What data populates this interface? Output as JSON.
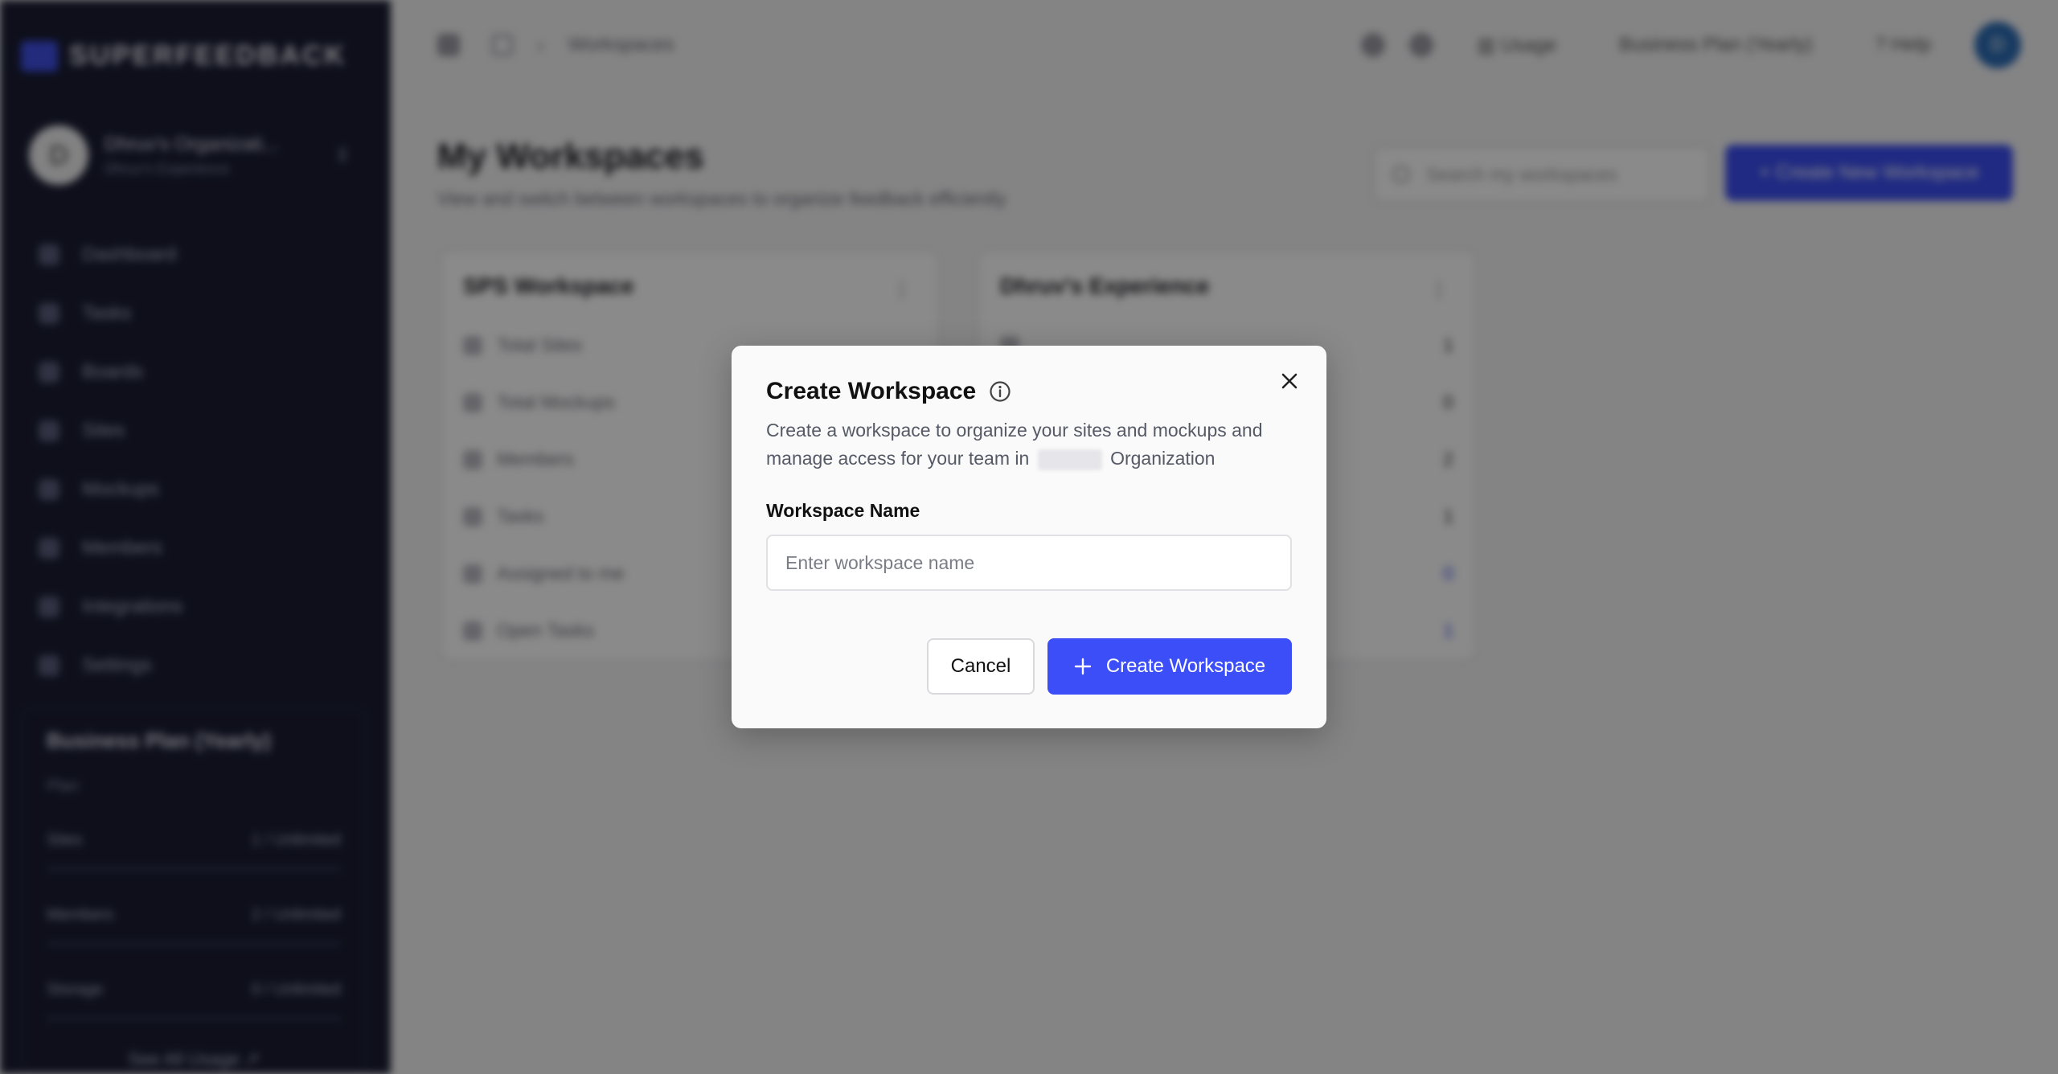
{
  "sidebar": {
    "brand": "SUPERFEEDBACK",
    "org": {
      "initial": "D",
      "name": "Dhruv's Organizati...",
      "sub": "Dhruv's Experience"
    },
    "nav": [
      "Dashboard",
      "Tasks",
      "Boards",
      "Sites",
      "Mockups",
      "Members",
      "Integrations",
      "Settings"
    ],
    "plan": {
      "title": "Business Plan (Yearly)",
      "sub": "Plan",
      "usage": [
        {
          "label": "Sites",
          "value": "1 / Unlimited"
        },
        {
          "label": "Members",
          "value": "2 / Unlimited"
        },
        {
          "label": "Storage",
          "value": "0 / Unlimited"
        }
      ],
      "see_all": "See All Usage"
    }
  },
  "header": {
    "breadcrumb": "Workspaces",
    "usage_label": "Usage",
    "plan_label": "Business Plan (Yearly)",
    "help_label": "Help",
    "avatar_initial": "D"
  },
  "main": {
    "title": "My Workspaces",
    "subtitle": "View and switch between workspaces to organize feedback efficiently",
    "search_placeholder": "Search my workspaces",
    "create_new_label": "+ Create New Workspace",
    "cards": [
      {
        "title": "SPS Workspace",
        "rows": [
          {
            "label": "Total Sites",
            "value": ""
          },
          {
            "label": "Total Mockups",
            "value": ""
          },
          {
            "label": "Members",
            "value": ""
          },
          {
            "label": "Tasks",
            "value": ""
          },
          {
            "label": "Assigned to me",
            "value": ""
          },
          {
            "label": "Open Tasks",
            "value": ""
          }
        ]
      },
      {
        "title": "Dhruv's Experience",
        "rows": [
          {
            "label": "",
            "value": "1"
          },
          {
            "label": "",
            "value": "0"
          },
          {
            "label": "",
            "value": "2"
          },
          {
            "label": "",
            "value": "1"
          },
          {
            "label": "",
            "value": "0"
          },
          {
            "label": "",
            "value": "1"
          }
        ]
      }
    ]
  },
  "dialog": {
    "title": "Create Workspace",
    "description_pre": "Create a workspace to organize your sites and mockups and manage access for your team in",
    "description_post": "Organization",
    "field_label": "Workspace Name",
    "field_value": "",
    "field_placeholder": "Enter workspace name",
    "cancel_label": "Cancel",
    "create_label": "Create Workspace",
    "accent": "#3b4ef8"
  }
}
